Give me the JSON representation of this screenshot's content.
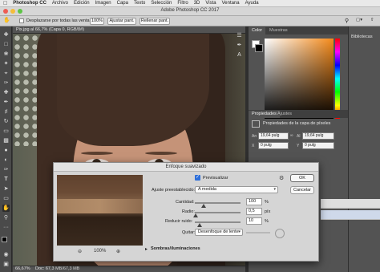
{
  "menubar": {
    "apple": "",
    "app": "Photoshop CC",
    "items": [
      "Archivo",
      "Edición",
      "Imagen",
      "Capa",
      "Texto",
      "Selección",
      "Filtro",
      "3D",
      "Vista",
      "Ventana",
      "Ayuda"
    ]
  },
  "window": {
    "title": "Adobe Photoshop CC 2017"
  },
  "options_bar": {
    "scroll_all_label": "Desplazarse por todas las ventanas",
    "zoom_value": "100%",
    "fit_screen": "Ajustar pant.",
    "fill_screen": "Rellenar pant."
  },
  "document": {
    "tab_label": "Pix.jpg al 66,7% (Capa 0, RGB/8#)",
    "zoom": "66,67%",
    "doc_size": "Doc: 67,3 MB/67,3 MB"
  },
  "panels": {
    "color_tab": "Color",
    "swatches_tab": "Muestras",
    "properties_tab": "Propiedades",
    "adjustments_tab": "Ajustes",
    "properties_title": "Propiedades de la capa de píxeles",
    "width_label": "An",
    "width_value": "19,64 pulg",
    "height_label": "Al",
    "height_value": "19,64 pulg",
    "x_label": "X",
    "x_value": "0 pulg",
    "y_label": "Y",
    "y_value": "0 pulg",
    "libraries": "Bibliotecas"
  },
  "dialog": {
    "title": "Enfoque suavizado",
    "preview_label": "Previsualizar",
    "preset_label": "Ajuste preestablecido:",
    "preset_value": "A medida",
    "amount_label": "Cantidad:",
    "amount_value": "100",
    "amount_unit": "%",
    "amount_fraction": 0.2,
    "radius_label": "Radio:",
    "radius_value": "0,5",
    "radius_unit": "píx",
    "radius_fraction": 0.01,
    "noise_label": "Reducir ruido:",
    "noise_value": "10",
    "noise_unit": "%",
    "noise_fraction": 0.1,
    "remove_label": "Quitar:",
    "remove_value": "Desenfoque de lente",
    "zoom_out_icon": "zoom-out",
    "zoom_level": "100%",
    "zoom_in_icon": "zoom-in",
    "shadows_label": "Sombras/iluminaciones",
    "ok_label": "OK",
    "cancel_label": "Cancelar"
  },
  "colors": {
    "accent": "#2e6fd9",
    "foreground_swatch": "#ffffff",
    "background_swatch": "#000000"
  }
}
